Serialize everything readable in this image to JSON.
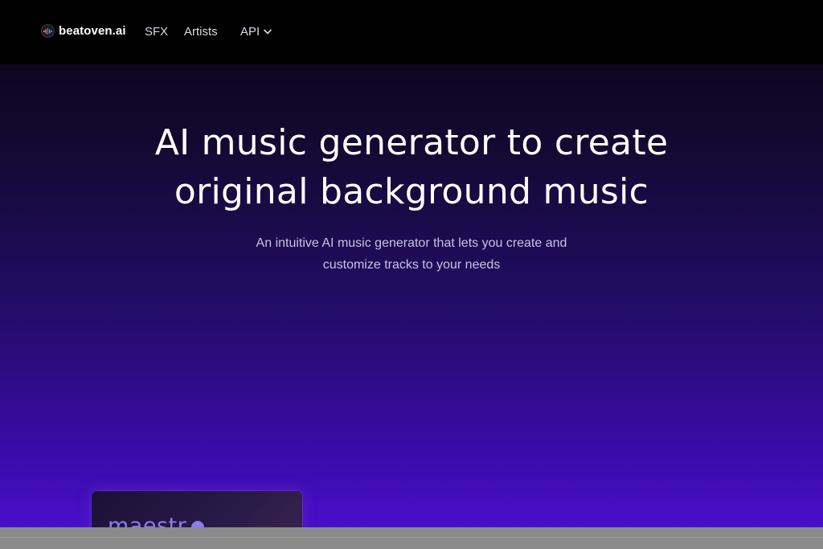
{
  "nav": {
    "brand": "beatoven.ai",
    "logo_icon": "waveform-logo-icon",
    "items": [
      {
        "label": "SFX"
      },
      {
        "label": "Artists"
      },
      {
        "label": "API",
        "icon": "chevron-down-icon"
      }
    ]
  },
  "hero": {
    "title_line1": "AI music generator to create",
    "title_line2": "original background music",
    "subtitle_line1": "An intuitive AI music generator that lets you create and",
    "subtitle_line2": "customize tracks to your needs"
  },
  "preview_card": {
    "title": "maestr"
  },
  "colors": {
    "nav_bg": "#000000",
    "hero_top": "#0d0620",
    "hero_bottom": "#4a0fc9",
    "card_accent": "#8b7cf0",
    "bottom_bar": "#8a8a8a"
  }
}
